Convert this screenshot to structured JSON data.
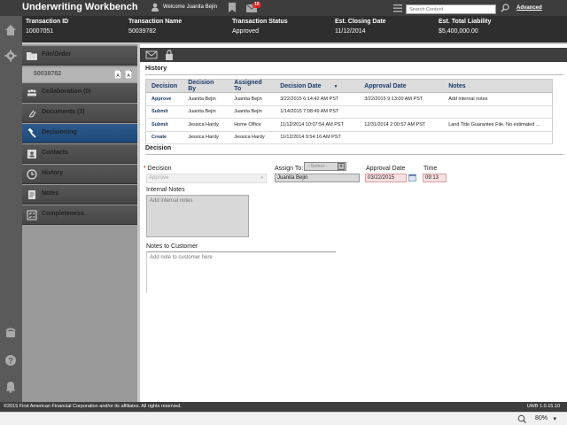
{
  "header": {
    "app_title": "Underwriting Workbench",
    "welcome": "Welcome Juanita Bejin",
    "mail_count": "10",
    "search_placeholder": "Search Content",
    "advanced": "Advanced"
  },
  "transaction": {
    "columns": [
      {
        "label": "Transaction ID",
        "value": "10007051"
      },
      {
        "label": "Transaction Name",
        "value": "50039782"
      },
      {
        "label": "Transaction Status",
        "value": "Approved"
      },
      {
        "label": "Est. Closing Date",
        "value": "11/12/2014"
      },
      {
        "label": "Est. Total Liability",
        "value": "$5,400,000.00"
      }
    ]
  },
  "nav": {
    "file_order": "File/Order",
    "order_number": "50039782",
    "items": [
      {
        "label": "Collaboration (0)",
        "icon": "collaboration-icon"
      },
      {
        "label": "Documents (3)",
        "icon": "paperclip-icon"
      },
      {
        "label": "Decisioning",
        "icon": "gavel-icon"
      },
      {
        "label": "Contacts",
        "icon": "contacts-icon"
      },
      {
        "label": "History",
        "icon": "clock-icon"
      },
      {
        "label": "Notes",
        "icon": "notes-icon"
      },
      {
        "label": "Completeness",
        "icon": "checklist-icon"
      }
    ]
  },
  "history": {
    "title": "History",
    "columns": [
      "Decision",
      "Decision By",
      "Assigned To",
      "Decision Date",
      "Approval Date",
      "Notes"
    ],
    "rows": [
      {
        "decision": "Approve",
        "by": "Juanita Bejin",
        "assigned": "Juanita Bejin",
        "date": "3/22/2015 6:14:42 AM PST",
        "approval": "3/22/2015 9:13:00 AM PST",
        "notes": "Add internal notes"
      },
      {
        "decision": "Submit",
        "by": "Juanita Bejin",
        "assigned": "Juanita Bejin",
        "date": "1/14/2015 7:08:49 AM PST",
        "approval": "",
        "notes": ""
      },
      {
        "decision": "Submit",
        "by": "Jessica Hardy",
        "assigned": "Home Office",
        "date": "11/12/2014 10:07:54 AM PST",
        "approval": "12/31/2014 2:00:57 AM PST",
        "notes": "Land Title Guarantee File. No estimated ..."
      },
      {
        "decision": "Create",
        "by": "Jessica Hardy",
        "assigned": "Jessica Hardy",
        "date": "11/12/2014 9:54:16 AM PST",
        "approval": "",
        "notes": ""
      }
    ]
  },
  "decision": {
    "title": "Decision",
    "decision_label": "Decision",
    "decision_value": "Approve",
    "assign_label": "Assign To:",
    "assign_select": "--Select--",
    "assign_value": "Juanita Bejin",
    "approval_date_label": "Approval Date",
    "approval_date_value": "03/22/2015",
    "time_label": "Time",
    "time_value": "09:13",
    "internal_notes_label": "Internal Notes",
    "internal_notes_placeholder": "Add internal notes",
    "customer_notes_label": "Notes to Customer",
    "customer_notes_placeholder": "Add note to customer here"
  },
  "footer": {
    "copyright": "©2015 First American Financial Corporation and/or its affiliates. All rights reserved.",
    "version": "UWB 1.0.15.10"
  },
  "statusbar": {
    "zoom": "80%"
  }
}
